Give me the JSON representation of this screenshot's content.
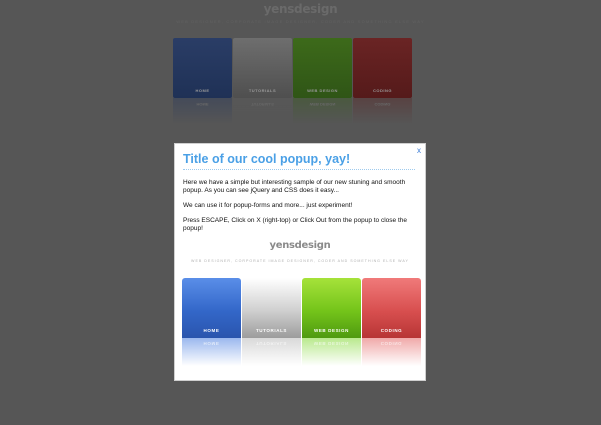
{
  "background": {
    "logo": "yensdesign",
    "tagline": "WEB DESIGNER, CORPORATE IMAGE DESIGNER, CODER AND SOMETHING ELSE WAY",
    "nav": [
      "HOME",
      "TUTORIALS",
      "WEB DESIGN",
      "CODING"
    ]
  },
  "popup": {
    "close_label": "x",
    "title": "Title of our cool popup, yay!",
    "paragraphs": [
      "Here we have a simple but interesting sample of our new stuning and smooth popup. As you can see jQuery and CSS does it easy...",
      "We can use it for popup-forms and more... just experiment!",
      "Press ESCAPE, Click on X (right-top) or Click Out from the popup to close the popup!"
    ],
    "logo": "yensdesign",
    "tagline": "WEB DESIGNER, CORPORATE IMAGE DESIGNER, CODER AND SOMETHING ELSE WAY",
    "nav": [
      {
        "label": "HOME",
        "color": "#3367c9"
      },
      {
        "label": "TUTORIALS",
        "color": "#cfcfcf"
      },
      {
        "label": "WEB DESIGN",
        "color": "#74c41a"
      },
      {
        "label": "CODING",
        "color": "#d84f4f"
      }
    ]
  },
  "colors": {
    "overlay": "#565656",
    "title": "#4aa0e6",
    "close": "#3a7bd5"
  }
}
